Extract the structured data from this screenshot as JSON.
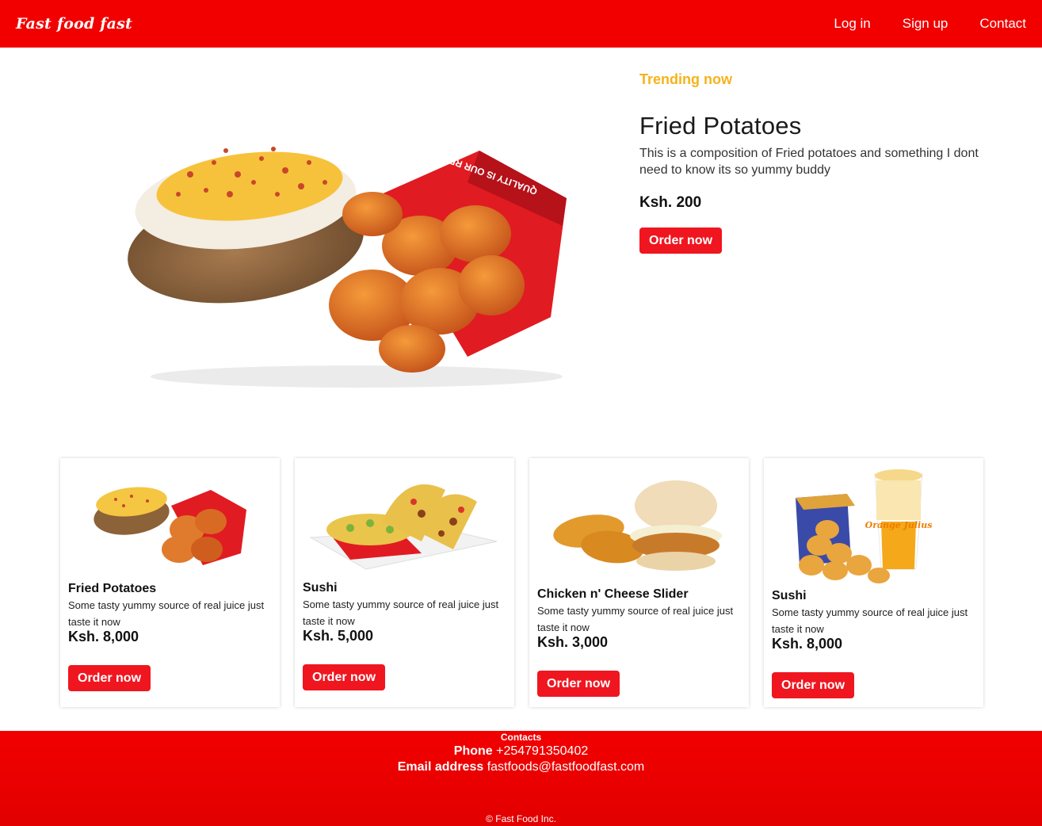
{
  "nav": {
    "brand": "Fast food fast",
    "links": [
      "Log in",
      "Sign up",
      "Contact"
    ]
  },
  "hero": {
    "badge": "Trending now",
    "title": "Fried Potatoes",
    "description": "This is a composition of Fried potatoes and something I dont need to know its so yummy buddy",
    "price": "Ksh. 200",
    "button": "Order now",
    "image_label": "QUALITY IS OUR RECIPE"
  },
  "cards": [
    {
      "title": "Fried Potatoes",
      "description": "Some tasty yummy source of real juice just taste it now",
      "price": "Ksh. 8,000",
      "button": "Order now",
      "image": "potato-nuggets"
    },
    {
      "title": "Sushi",
      "description": "Some tasty yummy source of real juice just taste it now",
      "price": "Ksh. 5,000",
      "button": "Order now",
      "image": "tacos-nachos"
    },
    {
      "title": "Chicken n' Cheese Slider",
      "description": "Some tasty yummy source of real juice just taste it now",
      "price": "Ksh. 3,000",
      "button": "Order now",
      "image": "slider-hashbrowns"
    },
    {
      "title": "Sushi",
      "description": "Some tasty yummy source of real juice just taste it now",
      "price": "Ksh. 8,000",
      "button": "Order now",
      "image": "nuggets-orange-julius",
      "cup_label": "Orange Julius"
    }
  ],
  "footer": {
    "heading": "Contacts",
    "phone_label": "Phone",
    "phone": "+254791350402",
    "email_label": "Email address",
    "email": "fastfoods@fastfoodfast.com",
    "copyright": "© Fast Food Inc."
  },
  "colors": {
    "brand_red": "#f20000",
    "button_red": "#ef1620",
    "trending": "#f7b21b"
  }
}
